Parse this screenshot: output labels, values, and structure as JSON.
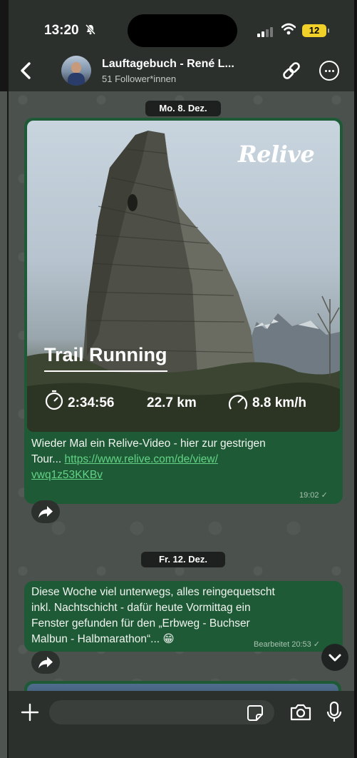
{
  "status_bar": {
    "time": "13:20",
    "battery": "12"
  },
  "header": {
    "title": "Lauftagebuch - René L...",
    "subtitle": "51 Follower*innen"
  },
  "messages": [
    {
      "date": "Mo. 8. Dez.",
      "media": {
        "brand": "Relive",
        "activity": "Trail Running",
        "duration": "2:34:56",
        "distance": "22.7 km",
        "speed": "8.8 km/h"
      },
      "text_line1": "Wieder Mal ein Relive-Video - hier zur gestrigen",
      "text_prefix": "Tour... ",
      "link_part1": "https://www.relive.com/de/view/",
      "link_part2": "vwq1z53KKBv",
      "time": "19:02"
    },
    {
      "date": "Fr. 12. Dez.",
      "lines": [
        "Diese Woche viel unterwegs, alles reingequetscht",
        "inkl. Nachtschicht - dafür heute Vormittag ein",
        "Fenster gefunden für den „Erbweg - Buchser",
        "Malbun - Halbmarathon“... 😁"
      ],
      "meta": "Bearbeitet 20:53"
    }
  ],
  "icons": {
    "back": "chevron-left-icon",
    "link": "link-icon",
    "more": "more-icon",
    "forward": "forward-icon",
    "scroll": "chevron-down-icon",
    "plus": "plus-icon",
    "sticker": "sticker-icon",
    "camera": "camera-icon",
    "mic": "microphone-icon"
  },
  "colors": {
    "bubble": "#1d5a35",
    "link": "#63d486",
    "bar": "#2b302d",
    "background": "#4b524d"
  }
}
